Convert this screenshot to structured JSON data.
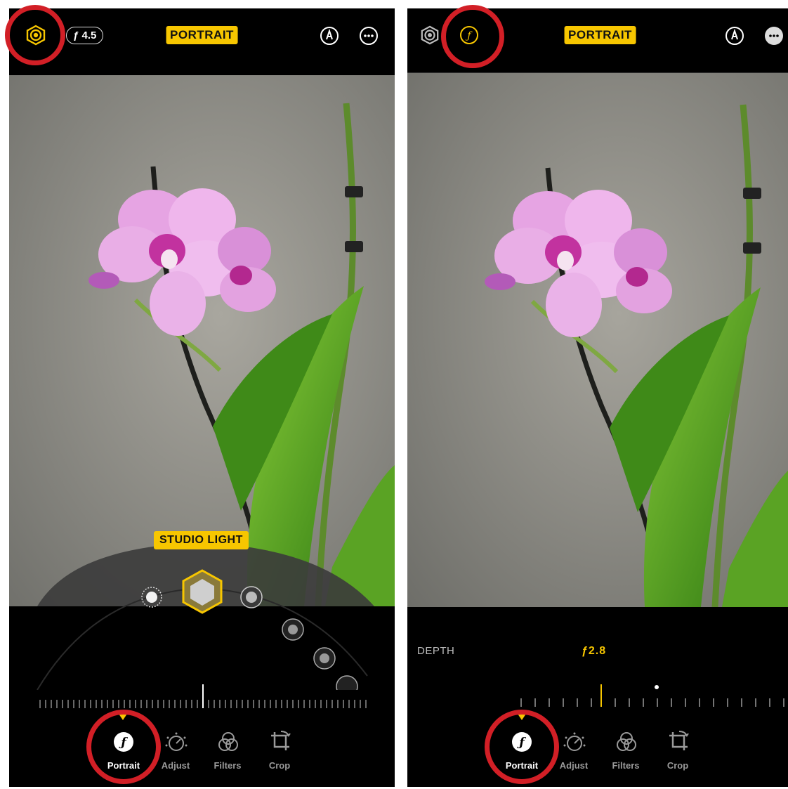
{
  "left_screen": {
    "mode_label": "PORTRAIT",
    "aperture_badge": "ƒ 4.5",
    "lighting_effect_label": "STUDIO LIGHT",
    "tools": [
      {
        "label": "Portrait",
        "icon": "f-stop-icon",
        "active": true
      },
      {
        "label": "Adjust",
        "icon": "adjust-dial-icon",
        "active": false
      },
      {
        "label": "Filters",
        "icon": "filters-icon",
        "active": false
      },
      {
        "label": "Crop",
        "icon": "crop-rotate-icon",
        "active": false
      }
    ]
  },
  "right_screen": {
    "mode_label": "PORTRAIT",
    "depth_label": "DEPTH",
    "depth_value": "ƒ2.8",
    "tools": [
      {
        "label": "Portrait",
        "icon": "f-stop-icon",
        "active": true
      },
      {
        "label": "Adjust",
        "icon": "adjust-dial-icon",
        "active": false
      },
      {
        "label": "Filters",
        "icon": "filters-icon",
        "active": false
      },
      {
        "label": "Crop",
        "icon": "crop-rotate-icon",
        "active": false
      }
    ]
  },
  "colors": {
    "accent_yellow": "#f7c600",
    "highlight_ring": "#d21f26",
    "leaf_green": "#4f9a22",
    "orchid_pink": "#d86bd0"
  }
}
